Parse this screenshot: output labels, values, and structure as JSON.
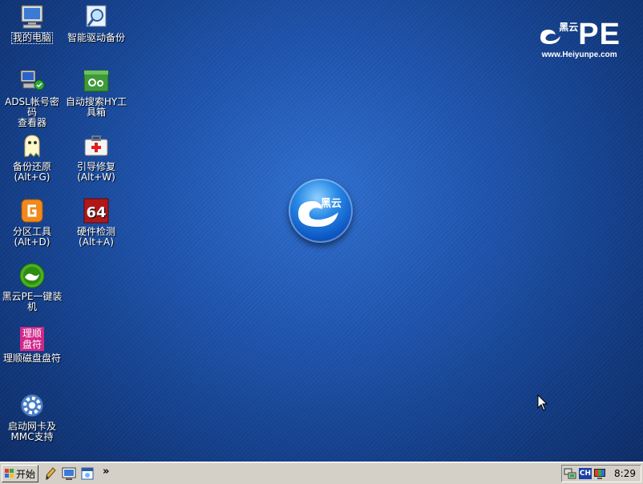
{
  "desktop_icons": [
    {
      "id": "my-computer",
      "label": "我的电脑",
      "icon": "computer-icon"
    },
    {
      "id": "driver-backup",
      "label": "智能驱动备份",
      "icon": "magnifier-document-icon"
    },
    {
      "id": "adsl-viewer",
      "label": "ADSL帐号密码\n查看器",
      "icon": "network-computer-icon"
    },
    {
      "id": "hy-toolbox",
      "label": "自动搜索HY工\n具箱",
      "icon": "toolbox-icon"
    },
    {
      "id": "backup-restore",
      "label": "备份还原\n(Alt+G)",
      "icon": "ghost-icon"
    },
    {
      "id": "boot-repair",
      "label": "引导修复\n(Alt+W)",
      "icon": "first-aid-kit-icon"
    },
    {
      "id": "partition-tool",
      "label": "分区工具\n(Alt+D)",
      "icon": "diskgenius-icon"
    },
    {
      "id": "hardware-check",
      "label": "硬件检测\n(Alt+A)",
      "icon": "aida64-icon"
    },
    {
      "id": "one-click-install",
      "label": "黑云PE一键装\n机",
      "icon": "heiyun-installer-icon"
    },
    {
      "id": "disk-letter",
      "label": "理顺磁盘盘符",
      "icon": "disk-letter-icon",
      "icon_text": "理顺\n盘符"
    },
    {
      "id": "nic-mmc",
      "label": "启动网卡及\nMMC支持",
      "icon": "gear-icon"
    }
  ],
  "brand": {
    "cn": "黑云",
    "pe": "PE",
    "url": "www.Heiyunpe.com"
  },
  "orb": {
    "text": "黑云"
  },
  "taskbar": {
    "start_label": "开始",
    "more": "»",
    "quick_launch": [
      "pencil-icon",
      "desktop-icon",
      "window-icon"
    ],
    "tray": {
      "icons": [
        "network-icon",
        "language-icon",
        "display-icon"
      ],
      "lang": "CH",
      "clock": "8:29"
    }
  },
  "colors": {
    "desktop": "#1f55b0",
    "taskbar": "#d4d0c8"
  }
}
